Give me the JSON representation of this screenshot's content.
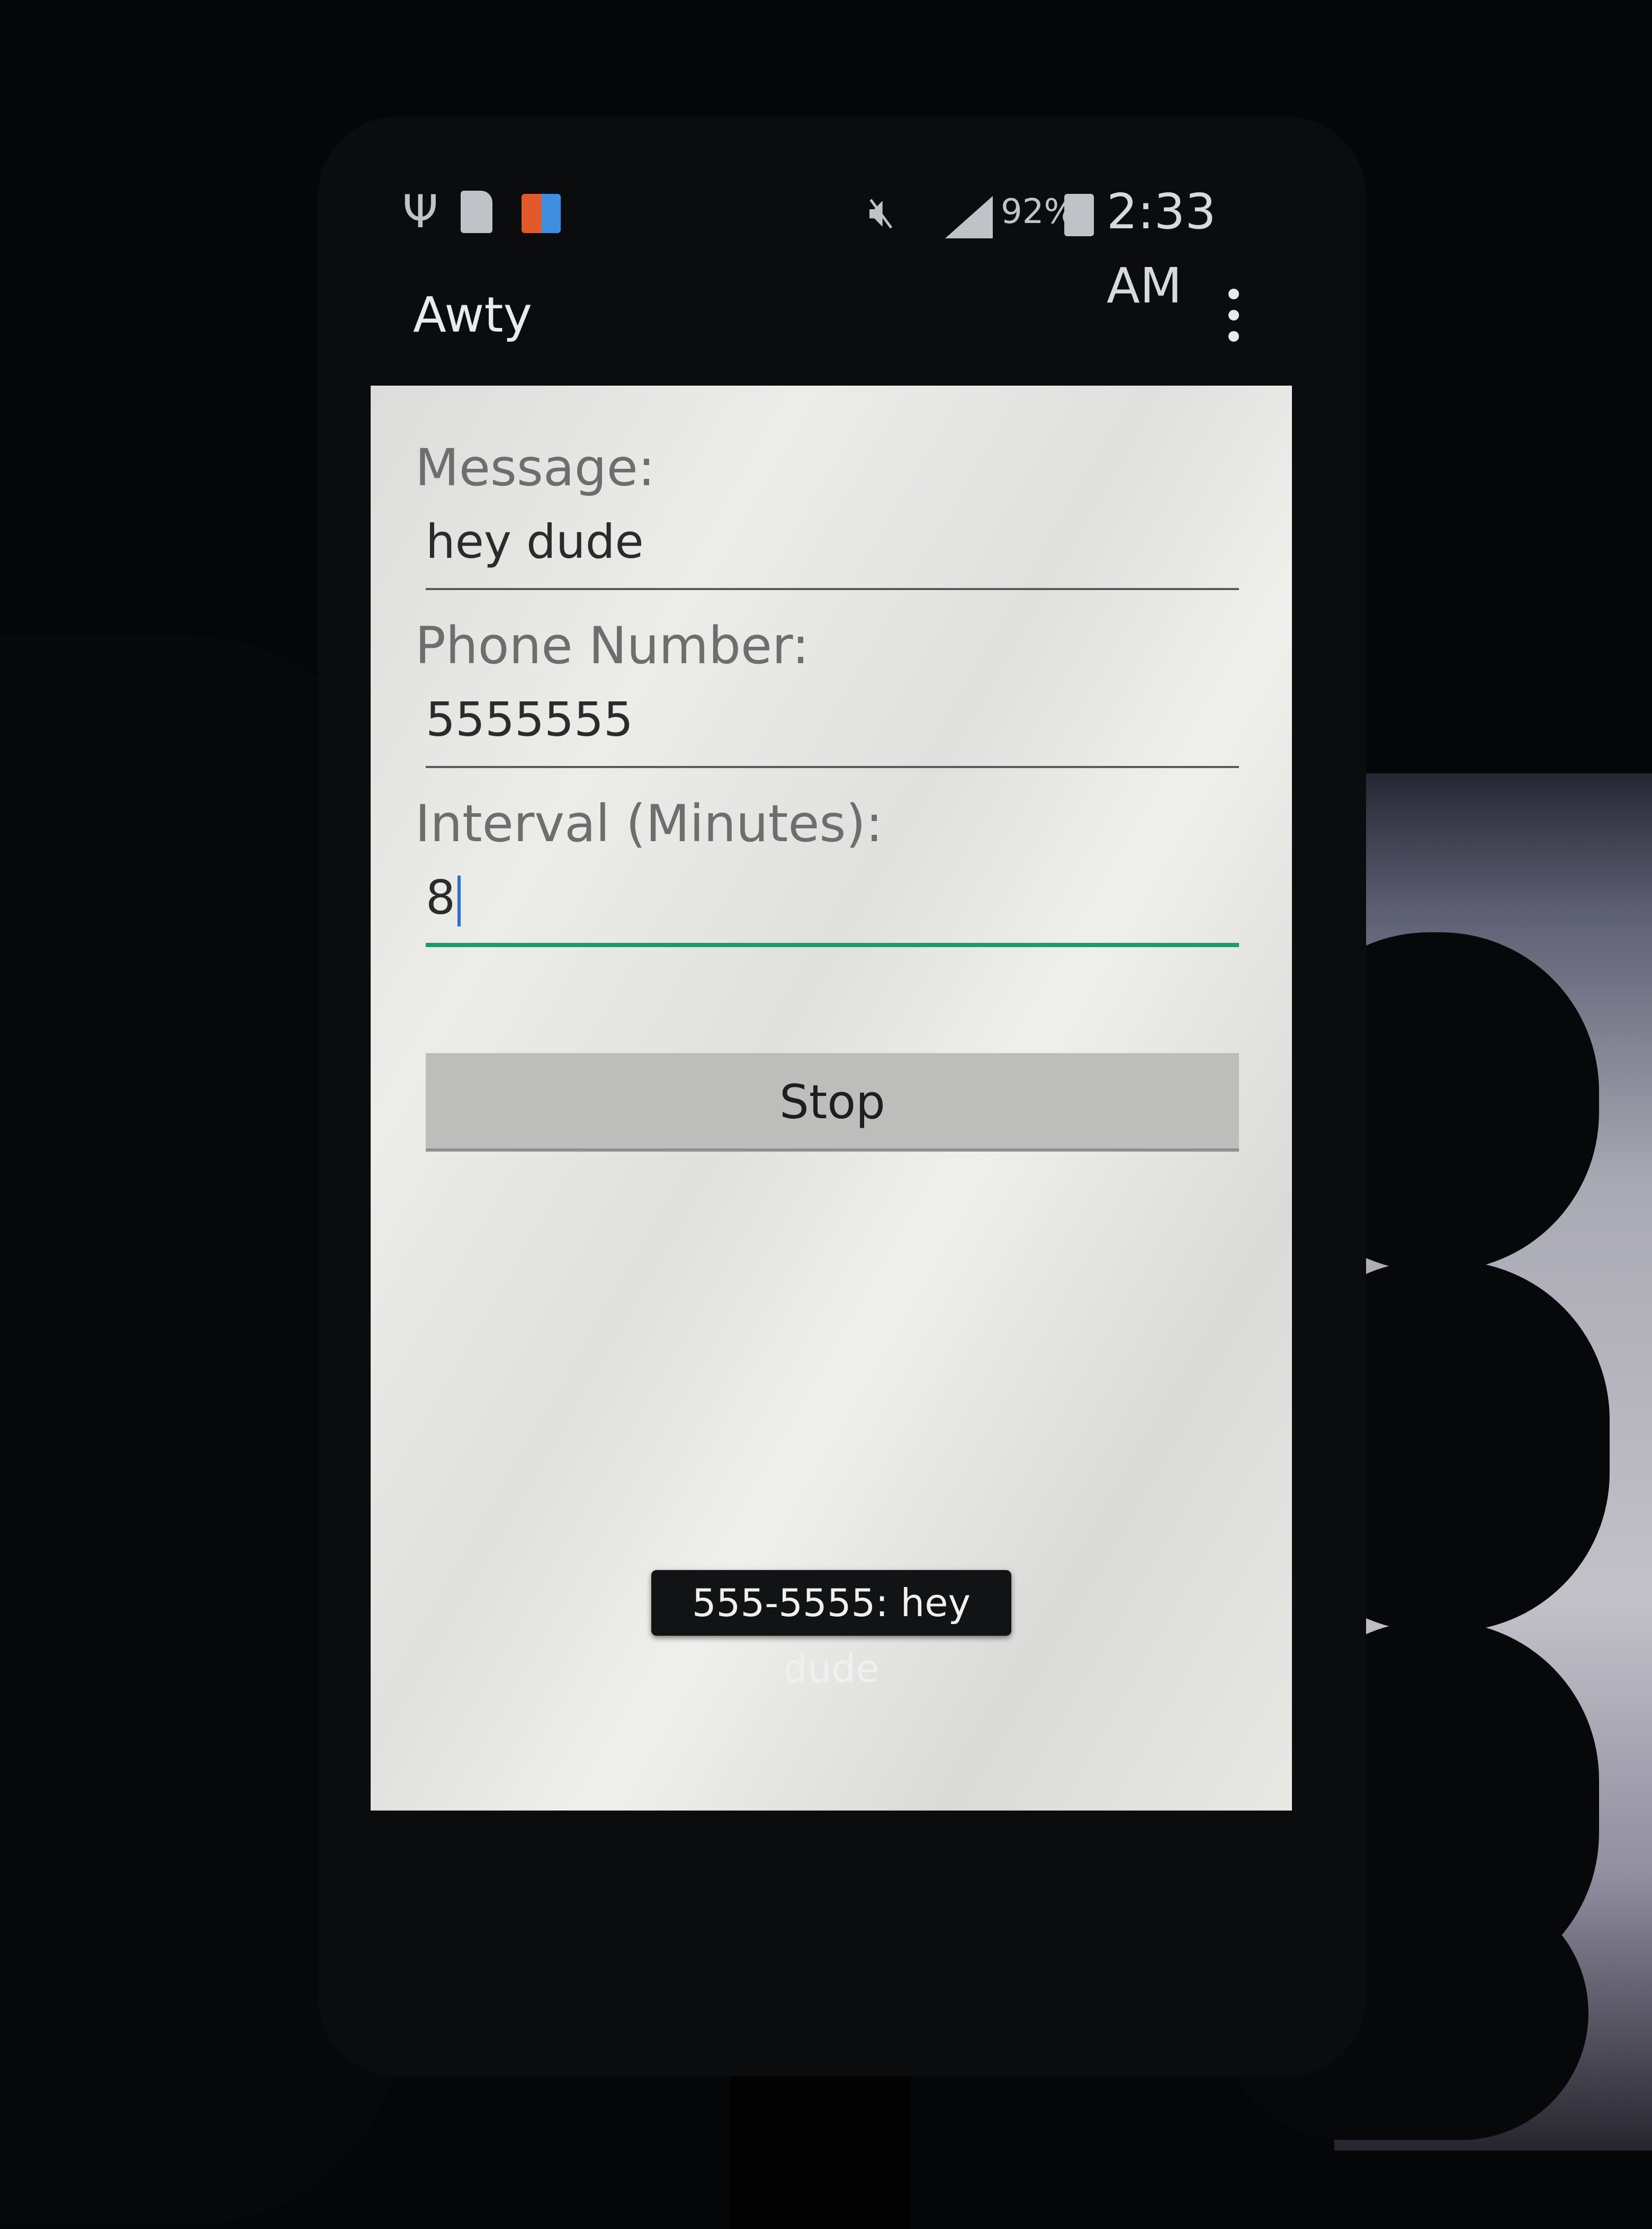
{
  "status_bar": {
    "battery_percent": "92%",
    "time": "2:33 AM",
    "icons": [
      "usb-icon",
      "sd-card-icon",
      "app-notification-icon",
      "mute-icon",
      "signal-icon",
      "battery-charging-icon"
    ]
  },
  "action_bar": {
    "title": "Awty",
    "menu_icon": "overflow-menu-icon"
  },
  "form": {
    "message_label": "Message:",
    "message_value": "hey dude",
    "phone_label": "Phone Number:",
    "phone_value": "5555555",
    "interval_label": "Interval (Minutes):",
    "interval_value": "8",
    "accent_color": "#1b9b69"
  },
  "actions": {
    "stop_label": "Stop"
  },
  "toast": {
    "text": "555-5555: hey dude"
  }
}
